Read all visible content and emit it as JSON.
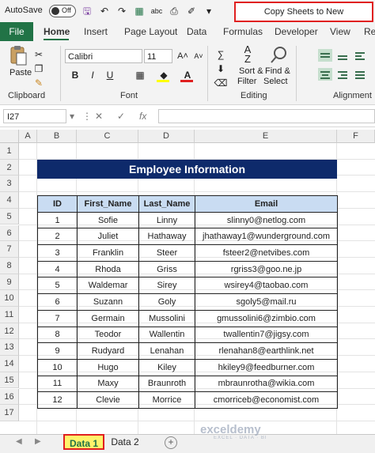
{
  "titlebar": {
    "autosave_label": "AutoSave",
    "autosave_state": "Off",
    "filename": "Copy Sheets to New Workbook.xlsx"
  },
  "menu": {
    "file": "File",
    "tabs": [
      "Home",
      "Insert",
      "Page Layout",
      "Data",
      "Formulas",
      "Developer",
      "View",
      "Re"
    ],
    "active_tab": "Home"
  },
  "ribbon": {
    "paste_label": "Paste",
    "clipboard_label": "Clipboard",
    "font_name": "Calibri",
    "font_size": "11",
    "font_label": "Font",
    "sort_filter_line1": "Sort &",
    "sort_filter_line2": "Filter",
    "find_select_line1": "Find &",
    "find_select_line2": "Select",
    "editing_label": "Editing",
    "alignment_label": "Alignment"
  },
  "formula_bar": {
    "name_box": "I27",
    "fx": "fx",
    "content": ""
  },
  "grid": {
    "columns": [
      "A",
      "B",
      "C",
      "D",
      "E",
      "F"
    ],
    "rows": [
      "1",
      "2",
      "3",
      "4",
      "5",
      "6",
      "7",
      "8",
      "9",
      "10",
      "11",
      "12",
      "13",
      "14",
      "15",
      "16",
      "17"
    ]
  },
  "sheet": {
    "banner_title": "Employee Information",
    "headers": [
      "ID",
      "First_Name",
      "Last_Name",
      "Email"
    ],
    "rows": [
      [
        "1",
        "Sofie",
        "Linny",
        "slinny0@netlog.com"
      ],
      [
        "2",
        "Juliet",
        "Hathaway",
        "jhathaway1@wunderground.com"
      ],
      [
        "3",
        "Franklin",
        "Steer",
        "fsteer2@netvibes.com"
      ],
      [
        "4",
        "Rhoda",
        "Griss",
        "rgriss3@goo.ne.jp"
      ],
      [
        "5",
        "Waldemar",
        "Sirey",
        "wsirey4@taobao.com"
      ],
      [
        "6",
        "Suzann",
        "Goly",
        "sgoly5@mail.ru"
      ],
      [
        "7",
        "Germain",
        "Mussolini",
        "gmussolini6@zimbio.com"
      ],
      [
        "8",
        "Teodor",
        "Wallentin",
        "twallentin7@jigsy.com"
      ],
      [
        "9",
        "Rudyard",
        "Lenahan",
        "rlenahan8@earthlink.net"
      ],
      [
        "10",
        "Hugo",
        "Kiley",
        "hkiley9@feedburner.com"
      ],
      [
        "11",
        "Maxy",
        "Braunroth",
        "mbraunrotha@wikia.com"
      ],
      [
        "12",
        "Clevie",
        "Morrice",
        "cmorriceb@economist.com"
      ]
    ]
  },
  "sheet_tabs": {
    "tabs": [
      "Data 1",
      "Data 2"
    ],
    "active": "Data 1",
    "add": "+"
  },
  "watermark": {
    "brand": "exceldemy",
    "tagline": "EXCEL · DATA · BI"
  },
  "colors": {
    "excel_green": "#217346",
    "banner_navy": "#0e2a6b",
    "header_blue": "#c9dcf2",
    "highlight_red": "#e02020",
    "tab_yellow": "#fff36b"
  }
}
